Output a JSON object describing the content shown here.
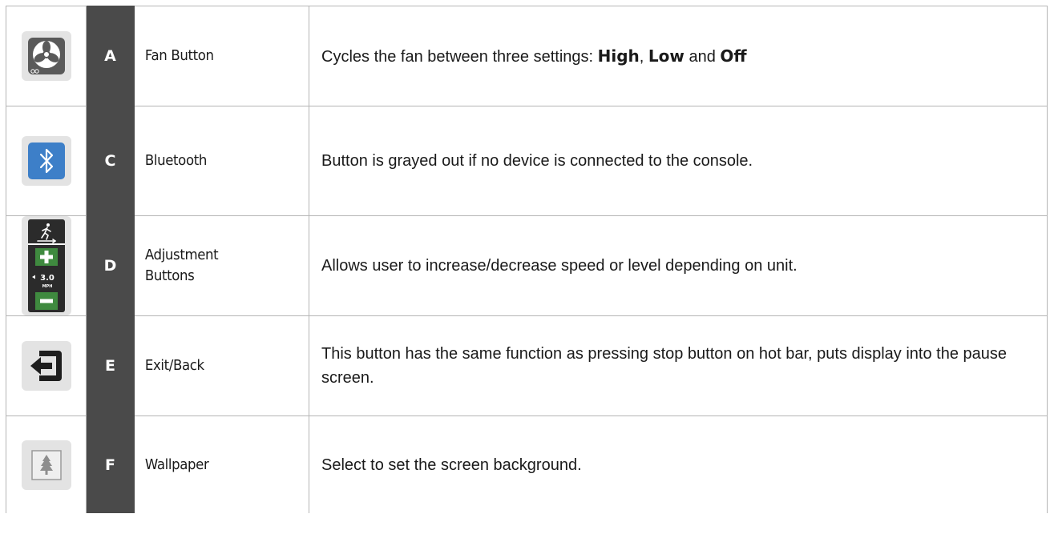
{
  "rows": [
    {
      "letter": "A",
      "name": "Fan Button",
      "icon": "fan-icon",
      "desc_parts": [
        "Cycles the fan between three settings: ",
        "High",
        ", ",
        "Low",
        " and ",
        "Off"
      ]
    },
    {
      "letter": "C",
      "name": "Bluetooth",
      "icon": "bluetooth-icon",
      "desc": "Button is grayed out if no device is connected to the console."
    },
    {
      "letter": "D",
      "name_line1": "Adjustment",
      "name_line2": "Buttons",
      "icon": "adjustment-buttons-icon",
      "icon_value": "3.0",
      "icon_unit": "MPH",
      "desc": "Allows user to increase/decrease speed or level depending on unit."
    },
    {
      "letter": "E",
      "name": "Exit/Back",
      "icon": "exit-icon",
      "desc": "This button has the same function as pressing stop button on hot bar, puts display into the pause screen."
    },
    {
      "letter": "F",
      "name": "Wallpaper",
      "icon": "wallpaper-tree-icon",
      "desc": "Select to set the screen background."
    }
  ],
  "colors": {
    "letter_column": "#4a4a4a",
    "bluetooth": "#3d7fc8",
    "adjust_green": "#3f8a3f",
    "icon_bg": "#e3e3e3"
  }
}
